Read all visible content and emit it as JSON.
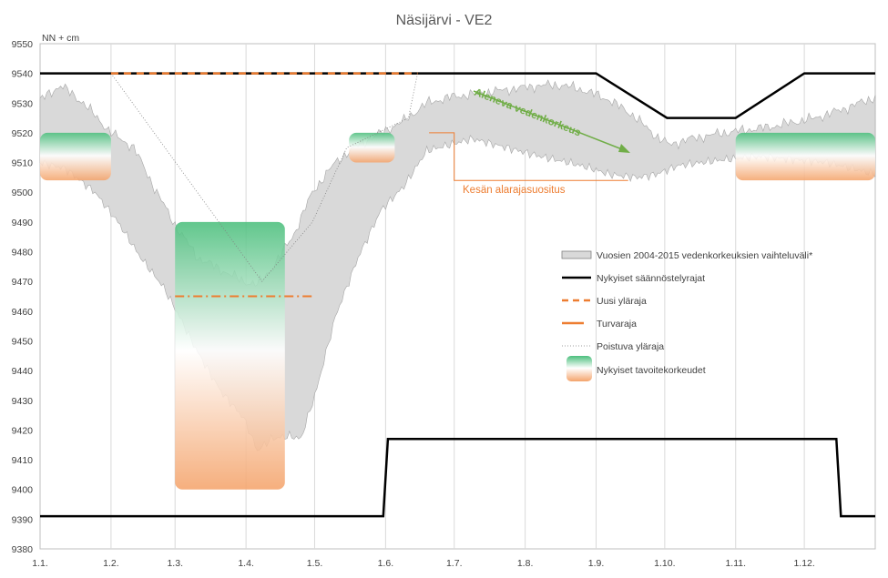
{
  "chart_data": {
    "type": "area",
    "title": "Näsijärvi - VE2",
    "ylabel": "NN + cm",
    "ylim": [
      9380,
      9550
    ],
    "y_ticks": [
      9380,
      9390,
      9400,
      9410,
      9420,
      9430,
      9440,
      9450,
      9460,
      9470,
      9480,
      9490,
      9500,
      9510,
      9520,
      9530,
      9540,
      9550
    ],
    "x_ticks": [
      "1.1.",
      "1.2.",
      "1.3.",
      "1.4.",
      "1.5.",
      "1.6.",
      "1.7.",
      "1.8.",
      "1.9.",
      "1.10.",
      "1.11.",
      "1.12."
    ],
    "x_unit": "day of year",
    "x_domain": [
      1,
      366
    ],
    "grid": "vertical",
    "legend_placement": "right-middle",
    "legend": [
      "Vuosien 2004-2015 vedenkorkeuksien vaihteluväli*",
      "Nykyiset säännöstelyrajat",
      "Uusi yläraja",
      "Turvaraja",
      "Poistuva yläraja",
      "Nykyiset tavoitekorkeudet"
    ],
    "annotations": {
      "trend": "Aleneva vedenkorkeus",
      "summer_min": "Kesän alarajasuositus"
    },
    "colors": {
      "band": "#d9d9d9",
      "band_edge": "#a6a6a6",
      "regulation": "#000000",
      "orange": "#ed7d31",
      "green": "#70ad47",
      "target_green": "#4cbf7d",
      "target_orange": "#f4a46c",
      "grid": "#d9d9d9"
    },
    "series": [
      {
        "name": "Nykyiset säännöstelyrajat",
        "upper": [
          [
            1,
            9540
          ],
          [
            244,
            9540
          ],
          [
            275,
            9525
          ],
          [
            305,
            9525
          ],
          [
            335,
            9540
          ],
          [
            366,
            9540
          ]
        ],
        "lower": [
          [
            1,
            9391
          ],
          [
            151,
            9391
          ],
          [
            153,
            9417
          ],
          [
            349,
            9417
          ],
          [
            351,
            9391
          ],
          [
            366,
            9391
          ]
        ]
      },
      {
        "name": "Uusi yläraja",
        "points": [
          [
            32,
            9540
          ],
          [
            166,
            9540
          ]
        ]
      },
      {
        "name": "Turvaraja",
        "points": [
          [
            60,
            9465
          ],
          [
            120,
            9465
          ]
        ]
      },
      {
        "name": "Poistuva yläraja",
        "points": [
          [
            32,
            9540
          ],
          [
            98,
            9470
          ],
          [
            120,
            9490
          ],
          [
            135,
            9515
          ],
          [
            162,
            9525
          ],
          [
            166,
            9540
          ]
        ]
      },
      {
        "name": "Vuosien 2004-2015 vedenkorkeuksien vaihteluväli*",
        "upper": [
          [
            1,
            9531
          ],
          [
            10,
            9536
          ],
          [
            20,
            9530
          ],
          [
            32,
            9520
          ],
          [
            42,
            9515
          ],
          [
            52,
            9500
          ],
          [
            60,
            9489
          ],
          [
            70,
            9478
          ],
          [
            80,
            9474
          ],
          [
            90,
            9470
          ],
          [
            96,
            9469
          ],
          [
            102,
            9474
          ],
          [
            112,
            9486
          ],
          [
            120,
            9500
          ],
          [
            130,
            9510
          ],
          [
            140,
            9516
          ],
          [
            150,
            9520
          ],
          [
            160,
            9524
          ],
          [
            170,
            9530
          ],
          [
            180,
            9532
          ],
          [
            190,
            9533
          ],
          [
            200,
            9534
          ],
          [
            210,
            9535
          ],
          [
            220,
            9536
          ],
          [
            230,
            9536
          ],
          [
            240,
            9534
          ],
          [
            250,
            9531
          ],
          [
            260,
            9526
          ],
          [
            270,
            9519
          ],
          [
            276,
            9516
          ],
          [
            285,
            9518
          ],
          [
            300,
            9520
          ],
          [
            320,
            9522
          ],
          [
            340,
            9525
          ],
          [
            352,
            9528
          ],
          [
            366,
            9532
          ]
        ],
        "lower": [
          [
            1,
            9510
          ],
          [
            12,
            9508
          ],
          [
            25,
            9500
          ],
          [
            35,
            9490
          ],
          [
            45,
            9478
          ],
          [
            55,
            9468
          ],
          [
            62,
            9458
          ],
          [
            70,
            9446
          ],
          [
            80,
            9433
          ],
          [
            90,
            9424
          ],
          [
            96,
            9413
          ],
          [
            102,
            9417
          ],
          [
            110,
            9418
          ],
          [
            115,
            9417
          ],
          [
            122,
            9434
          ],
          [
            130,
            9458
          ],
          [
            140,
            9478
          ],
          [
            150,
            9494
          ],
          [
            160,
            9502
          ],
          [
            170,
            9514
          ],
          [
            180,
            9516
          ],
          [
            190,
            9518
          ],
          [
            200,
            9516
          ],
          [
            210,
            9514
          ],
          [
            220,
            9512
          ],
          [
            232,
            9510
          ],
          [
            242,
            9508
          ],
          [
            250,
            9506
          ],
          [
            262,
            9505
          ],
          [
            270,
            9506
          ],
          [
            280,
            9509
          ],
          [
            290,
            9510
          ],
          [
            300,
            9511
          ],
          [
            315,
            9512
          ],
          [
            330,
            9511
          ],
          [
            345,
            9510
          ],
          [
            356,
            9508
          ],
          [
            366,
            9506
          ]
        ]
      },
      {
        "name": "Nykyiset tavoitekorkeudet",
        "boxes": [
          {
            "x": [
              1,
              32
            ],
            "y": [
              9504,
              9520
            ]
          },
          {
            "x": [
              60,
              108
            ],
            "y": [
              9400,
              9490
            ]
          },
          {
            "x": [
              136,
              156
            ],
            "y": [
              9510,
              9520
            ]
          },
          {
            "x": [
              305,
              366
            ],
            "y": [
              9504,
              9520
            ]
          }
        ]
      },
      {
        "name": "Kesän alarajasuositus",
        "points": [
          [
            171,
            9520
          ],
          [
            182,
            9520
          ],
          [
            182,
            9504
          ],
          [
            258,
            9504
          ]
        ]
      }
    ]
  }
}
